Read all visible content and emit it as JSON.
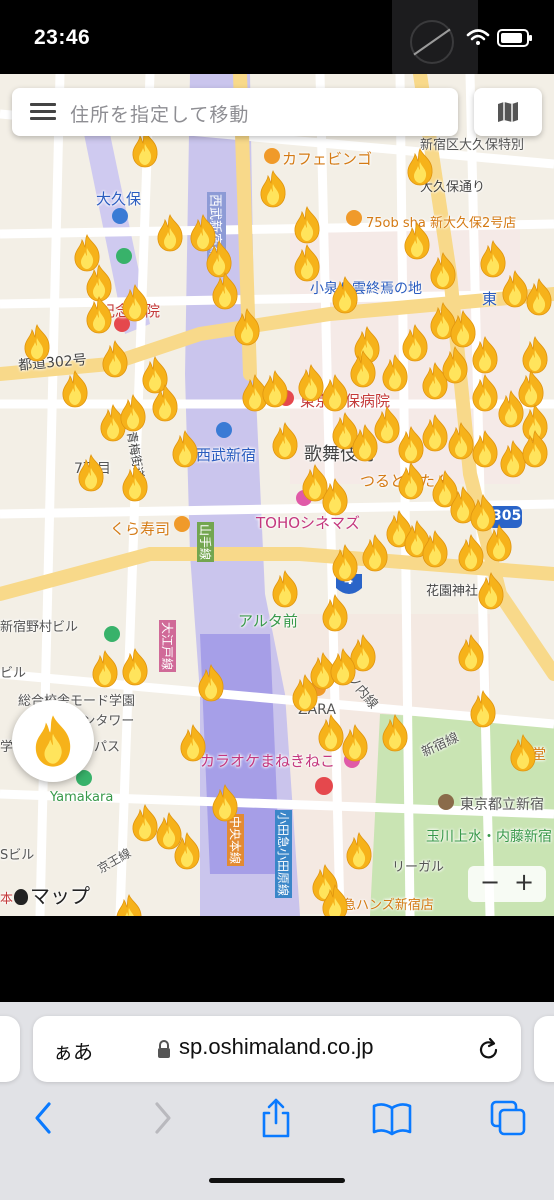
{
  "status_bar": {
    "time": "23:46"
  },
  "search": {
    "placeholder": "住所を指定して移動"
  },
  "map": {
    "labels": {
      "cafe": "カフェビンゴ",
      "okubo_dori": "大久保通り",
      "shinjuku_ku_okubo": "新宿区大久保特別",
      "okubo_station": "大久保",
      "seibu_shinjuku_line": "西武新宿線",
      "restaurant": "75ob sha 新大久保2号店",
      "koizumi_yakumo": "小泉八雲終焉の地",
      "hospital": "記念病院",
      "higashi": "東",
      "toei_302": "都道302号",
      "ome_kaido": "青梅街道",
      "seibu_shinjuku_station": "西武新宿",
      "kabuki": "歌舞伎町",
      "tokyo_hospital": "東京都保病院",
      "tsurutontan": "つるとんたん",
      "chome7": "7丁目",
      "toho": "TOHOシネマズ",
      "route305": "305",
      "kurazushi": "くら寿司",
      "yamanote": "山手線",
      "route4": "4",
      "hanazono": "花園神社",
      "shinjuku_nomura": "新宿野村ビル",
      "alta": "アルタ前",
      "ome_line": "大江戸線",
      "marunouchi": "丸ノ内線",
      "biru": "ビル",
      "mode_gakuen": "総合校舎モード学園",
      "cocoon": "コクーンタワー",
      "zara": "ZARA",
      "shinjuku_line": "新宿線",
      "karaoke": "カラオケまねきねこ",
      "setagaya": "世堂",
      "gaku": "学",
      "pasu": "パス",
      "yamakara": "Yamakara",
      "chuo": "中央本線",
      "odakyu": "小田急小田原線",
      "tokyo_metro_shinjuku": "東京都立新宿",
      "tamagawa": "玉川上水・内藤新宿",
      "s_biru": "Sビル",
      "keio": "京王線",
      "regal": "リーガル",
      "tokyu_hands": "東急ハンズ新宿店",
      "maps_brand": "マップ",
      "hon": "本"
    },
    "zoom": {
      "minus": "−",
      "plus": "+"
    }
  },
  "browser": {
    "aa_label": "ぁあ",
    "url": "sp.oshimaland.co.jp"
  },
  "colors": {
    "map_bg": "#f3efe6",
    "road": "#ffffff",
    "major_road": "#f8d98a",
    "rail_area": "#b9b3ee",
    "park": "#c9e4b3",
    "flame_outer": "#f6b21a",
    "flame_inner": "#ffe45c",
    "ios_blue": "#0a7aff"
  }
}
